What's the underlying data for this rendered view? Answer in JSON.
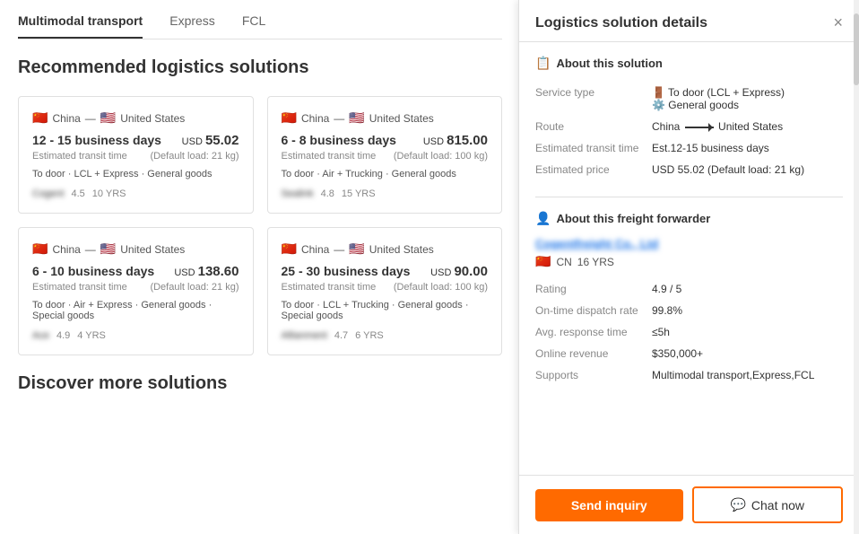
{
  "tabs": [
    {
      "label": "Multimodal transport",
      "active": true
    },
    {
      "label": "Express",
      "active": false
    },
    {
      "label": "FCL",
      "active": false
    }
  ],
  "section_title": "Recommended logistics solutions",
  "cards": [
    {
      "route_from": "China",
      "route_to": "United States",
      "days": "12 - 15 business days",
      "price": "55.02",
      "currency": "USD",
      "transit_label": "Estimated transit time",
      "default_load": "(Default load: 21 kg)",
      "service": "To door · LCL + Express · General goods",
      "company": "Cogent",
      "rating": "4.5",
      "yrs": "10 YRS"
    },
    {
      "route_from": "China",
      "route_to": "United States",
      "days": "6 - 8 business days",
      "price": "815.00",
      "currency": "USD",
      "transit_label": "Estimated transit time",
      "default_load": "(Default load: 100 kg)",
      "service": "To door · Air + Trucking · General goods",
      "company": "Sealink",
      "rating": "4.8",
      "yrs": "15 YRS"
    },
    {
      "route_from": "China",
      "route_to": "United States",
      "days": "6 - 10 business days",
      "price": "138.60",
      "currency": "USD",
      "transit_label": "Estimated transit time",
      "default_load": "(Default load: 21 kg)",
      "service": "To door · Air + Express · General goods · Special goods",
      "company": "Ace",
      "rating": "4.9",
      "yrs": "4 YRS"
    },
    {
      "route_from": "China",
      "route_to": "United States",
      "days": "25 - 30 business days",
      "price": "90.00",
      "currency": "USD",
      "transit_label": "Estimated transit time",
      "default_load": "(Default load: 100 kg)",
      "service": "To door · LCL + Trucking · General goods · Special goods",
      "company": "Allianment",
      "rating": "4.7",
      "yrs": "6 YRS"
    }
  ],
  "discover_title": "Discover more solutions",
  "panel": {
    "title": "Logistics solution details",
    "close_label": "×",
    "about_solution_label": "About this solution",
    "fields": [
      {
        "key": "Service type",
        "value": "To door (LCL + Express)\nGeneral goods"
      },
      {
        "key": "Route",
        "value": "China → United States"
      },
      {
        "key": "Estimated transit time",
        "value": "Est.12-15 business days"
      },
      {
        "key": "Estimated price",
        "value": "USD  55.02 (Default load: 21 kg)"
      }
    ],
    "about_forwarder_label": "About this freight forwarder",
    "forwarder_name": "Cogentfreight Co., Ltd",
    "forwarder_country": "CN",
    "forwarder_yrs": "16 YRS",
    "rating_label": "Rating",
    "rating_value": "4.9 / 5",
    "dispatch_label": "On-time dispatch rate",
    "dispatch_value": "99.8%",
    "response_label": "Avg. response time",
    "response_value": "≤5h",
    "revenue_label": "Online revenue",
    "revenue_value": "$350,000+",
    "supports_label": "Supports",
    "supports_value": "Multimodal transport,Express,FCL",
    "send_inquiry_label": "Send inquiry",
    "chat_label": "Chat now",
    "chat_icon": "💬"
  }
}
